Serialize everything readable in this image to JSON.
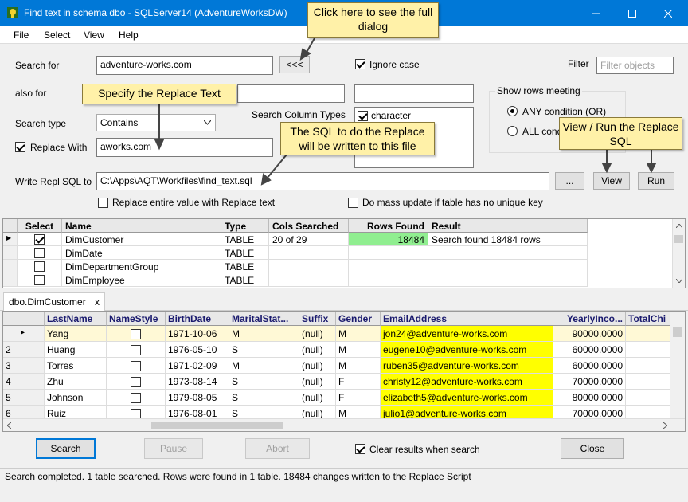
{
  "window": {
    "title": "Find text  in schema dbo - SQLServer14 (AdventureWorksDW)"
  },
  "menu": [
    "File",
    "Select",
    "View",
    "Help"
  ],
  "form": {
    "search_for_label": "Search for",
    "search_for_value": "adventure-works.com",
    "toggle_button": "<<<",
    "ignore_case_label": "Ignore case",
    "filter_label": "Filter",
    "filter_placeholder": "Filter objects",
    "also_for_label": "also for",
    "search_type_label": "Search type",
    "search_type_value": "Contains",
    "search_column_types_label": "Search Column Types",
    "column_type_character": "character",
    "replace_with_label": "Replace With",
    "replace_with_value": "aworks.com",
    "write_repl_sql_label": "Write Repl SQL to",
    "write_repl_sql_value": "C:\\Apps\\AQT\\Workfiles\\find_text.sql",
    "browse_button": "...",
    "replace_entire_label": "Replace entire value with Replace text",
    "mass_update_label": "Do mass update if table has no unique key",
    "show_rows_label": "Show rows meeting",
    "any_condition_label": "ANY condition (OR)",
    "all_condition_label": "ALL cond",
    "view_button": "View",
    "run_button": "Run"
  },
  "callouts": {
    "full_dialog": "Click here to see the full dialog",
    "replace_text": "Specify the Replace Text",
    "sql_replace": "The SQL to do the Replace will be written to this file",
    "view_run": "View / Run the Replace SQL"
  },
  "results_table": {
    "columns": [
      "Select",
      "Name",
      "Type",
      "Cols Searched",
      "Rows Found",
      "Result"
    ],
    "rows": [
      {
        "selected": true,
        "name": "DimCustomer",
        "type": "TABLE",
        "cols": "20 of 29",
        "rows_found": "18484",
        "result": "Search found 18484 rows"
      },
      {
        "selected": false,
        "name": "DimDate",
        "type": "TABLE",
        "cols": "",
        "rows_found": "",
        "result": ""
      },
      {
        "selected": false,
        "name": "DimDepartmentGroup",
        "type": "TABLE",
        "cols": "",
        "rows_found": "",
        "result": ""
      },
      {
        "selected": false,
        "name": "DimEmployee",
        "type": "TABLE",
        "cols": "",
        "rows_found": "",
        "result": ""
      }
    ]
  },
  "detail_tab": {
    "label": "dbo.DimCustomer",
    "close": "x"
  },
  "detail_table": {
    "columns": [
      "LastName",
      "NameStyle",
      "BirthDate",
      "MaritalStat...",
      "Suffix",
      "Gender",
      "EmailAddress",
      "YearlyInco...",
      "TotalChi"
    ],
    "rows": [
      {
        "num": "",
        "last": "Yang",
        "birth": "1971-10-06",
        "marital": "M",
        "suffix": "(null)",
        "gender": "M",
        "email": "jon24@adventure-works.com",
        "income": "90000.0000"
      },
      {
        "num": "2",
        "last": "Huang",
        "birth": "1976-05-10",
        "marital": "S",
        "suffix": "(null)",
        "gender": "M",
        "email": "eugene10@adventure-works.com",
        "income": "60000.0000"
      },
      {
        "num": "3",
        "last": "Torres",
        "birth": "1971-02-09",
        "marital": "M",
        "suffix": "(null)",
        "gender": "M",
        "email": "ruben35@adventure-works.com",
        "income": "60000.0000"
      },
      {
        "num": "4",
        "last": "Zhu",
        "birth": "1973-08-14",
        "marital": "S",
        "suffix": "(null)",
        "gender": "F",
        "email": "christy12@adventure-works.com",
        "income": "70000.0000"
      },
      {
        "num": "5",
        "last": "Johnson",
        "birth": "1979-08-05",
        "marital": "S",
        "suffix": "(null)",
        "gender": "F",
        "email": "elizabeth5@adventure-works.com",
        "income": "80000.0000"
      },
      {
        "num": "6",
        "last": "Ruiz",
        "birth": "1976-08-01",
        "marital": "S",
        "suffix": "(null)",
        "gender": "M",
        "email": "julio1@adventure-works.com",
        "income": "70000.0000"
      }
    ]
  },
  "bottom": {
    "search_button": "Search",
    "pause_button": "Pause",
    "abort_button": "Abort",
    "clear_results_label": "Clear results when search",
    "close_button": "Close"
  },
  "status": "Search completed. 1 table searched. Rows were found in 1 table. 18484 changes written to the Replace Script",
  "colors": {
    "titlebar": "#0078d7",
    "callout": "#fff1a8",
    "rows_found_highlight": "#90ee90",
    "email_highlight": "#ffff00"
  }
}
